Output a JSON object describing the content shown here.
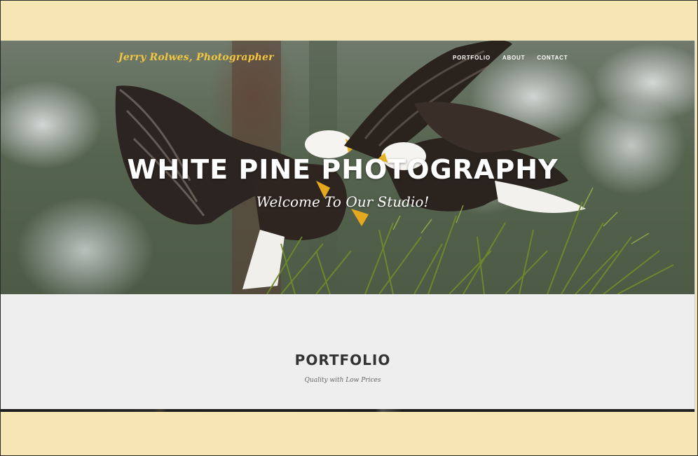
{
  "site": {
    "brand": "Jerry Rolwes, Photographer"
  },
  "nav": {
    "items": [
      {
        "label": "PORTFOLIO"
      },
      {
        "label": "ABOUT"
      },
      {
        "label": "CONTACT"
      }
    ]
  },
  "hero": {
    "title": "WHITE PINE PHOTOGRAPHY",
    "subtitle": "Welcome To Our Studio!",
    "image_subject": "two bald eagles landing on a snowy white pine"
  },
  "portfolio": {
    "title": "PORTFOLIO",
    "subtitle": "Quality with Low Prices"
  },
  "colors": {
    "page_background": "#f6e6b3",
    "brand_accent": "#f2c641",
    "section_background": "#eeeeee",
    "heading_text": "#333333",
    "nav_text": "#ffffff"
  }
}
